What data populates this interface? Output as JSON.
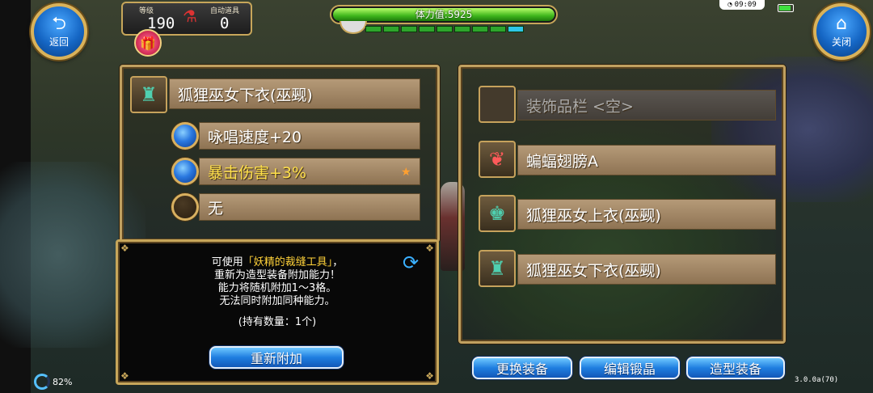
{
  "top_bar": {
    "back_label": "返回",
    "close_label": "关闭",
    "level_label": "等级",
    "level_value": "190",
    "auto_item_label": "自动道具",
    "auto_item_value": "0",
    "stamina_text": "体力值:5925",
    "stamina_fraction": 1.0,
    "clock": "09:09"
  },
  "equip_detail": {
    "item_name": "狐狸巫女下衣(巫觋)",
    "abilities": [
      {
        "text": "咏唱速度+20",
        "highlight": false
      },
      {
        "text": "暴击伤害+3%",
        "highlight": true
      },
      {
        "text": "无",
        "highlight": false
      }
    ]
  },
  "info": {
    "line1_prefix": "可使用",
    "line1_highlight": "「妖精的裁缝工具」",
    "line1_suffix": "，",
    "line2": "重新为造型装备附加能力！",
    "line3": "能力将随机附加1～3格。",
    "line4": "无法同时附加同种能力。",
    "count": "(持有数量：1个)",
    "reattach_label": "重新附加"
  },
  "slots": [
    {
      "label": "装饰品栏 <空>",
      "empty": true,
      "icon": "empty-slot-icon"
    },
    {
      "label": "蝙蝠翅膀A",
      "empty": false,
      "icon": "bat-wing-icon"
    },
    {
      "label": "狐狸巫女上衣(巫觋)",
      "empty": false,
      "icon": "top-garment-icon"
    },
    {
      "label": "狐狸巫女下衣(巫觋)",
      "empty": false,
      "icon": "bottom-garment-icon"
    }
  ],
  "bottom_buttons": {
    "change_equip": "更换装备",
    "edit_crystal": "编辑锻晶",
    "costume_equip": "造型装备"
  },
  "status": {
    "percent": "82%",
    "version": "3.0.0a(70)"
  }
}
